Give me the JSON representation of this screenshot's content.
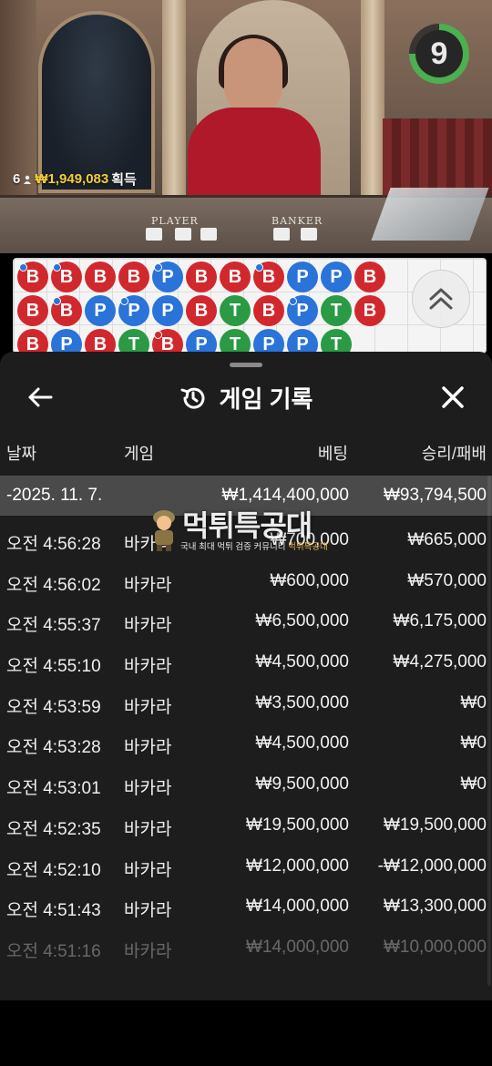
{
  "video": {
    "player_label": "PLAYER",
    "banker_label": "BANKER",
    "winners_count": "6",
    "winnings_amount": "₩1,949,083",
    "winnings_suffix": "획득",
    "timer": "9"
  },
  "roadmap": {
    "rows": [
      [
        {
          "r": "B",
          "dot": "blue"
        },
        {
          "r": "B",
          "dot": "blue"
        },
        {
          "r": "B"
        },
        {
          "r": "B"
        },
        {
          "r": "P",
          "dot": "blue"
        },
        {
          "r": "B"
        },
        {
          "r": "B"
        },
        {
          "r": "B",
          "dot": "blue"
        },
        {
          "r": "P"
        },
        {
          "r": "P"
        },
        {
          "r": "B"
        }
      ],
      [
        {
          "r": "B"
        },
        {
          "r": "B",
          "dot": "blue"
        },
        {
          "r": "P"
        },
        {
          "r": "P",
          "dot": "blue"
        },
        {
          "r": "P"
        },
        {
          "r": "B"
        },
        {
          "r": "T"
        },
        {
          "r": "B"
        },
        {
          "r": "P",
          "dot": "blue"
        },
        {
          "r": "T"
        },
        {
          "r": "B"
        }
      ],
      [
        {
          "r": "B"
        },
        {
          "r": "P"
        },
        {
          "r": "B"
        },
        {
          "r": "T"
        },
        {
          "r": "B",
          "dot": "red"
        },
        {
          "r": "P"
        },
        {
          "r": "T"
        },
        {
          "r": "P"
        },
        {
          "r": "P"
        },
        {
          "r": "T"
        }
      ]
    ],
    "colors": {
      "B": "#d1282e",
      "P": "#2a73d8",
      "T": "#2a9a44"
    }
  },
  "panel": {
    "title": "게임 기록",
    "headers": {
      "date": "날짜",
      "game": "게임",
      "bet": "베팅",
      "win": "승리/패배"
    },
    "total": {
      "date": "-2025. 11. 7.",
      "bet": "₩1,414,400,000",
      "win": "₩93,794,500"
    },
    "rows": [
      {
        "time": "오전 4:56:28",
        "game": "바카라",
        "bet": "₩700,000",
        "win": "₩665,000"
      },
      {
        "time": "오전 4:56:02",
        "game": "바카라",
        "bet": "₩600,000",
        "win": "₩570,000"
      },
      {
        "time": "오전 4:55:37",
        "game": "바카라",
        "bet": "₩6,500,000",
        "win": "₩6,175,000"
      },
      {
        "time": "오전 4:55:10",
        "game": "바카라",
        "bet": "₩4,500,000",
        "win": "₩4,275,000"
      },
      {
        "time": "오전 4:53:59",
        "game": "바카라",
        "bet": "₩3,500,000",
        "win": "₩0"
      },
      {
        "time": "오전 4:53:28",
        "game": "바카라",
        "bet": "₩4,500,000",
        "win": "₩0"
      },
      {
        "time": "오전 4:53:01",
        "game": "바카라",
        "bet": "₩9,500,000",
        "win": "₩0"
      },
      {
        "time": "오전 4:52:35",
        "game": "바카라",
        "bet": "₩19,500,000",
        "win": "₩19,500,000"
      },
      {
        "time": "오전 4:52:10",
        "game": "바카라",
        "bet": "₩12,000,000",
        "win": "-₩12,000,000"
      },
      {
        "time": "오전 4:51:43",
        "game": "바카라",
        "bet": "₩14,000,000",
        "win": "₩13,300,000"
      },
      {
        "time": "오전 4:51:16",
        "game": "바카라",
        "bet": "₩14,000,000",
        "win": "₩10,000,000"
      }
    ]
  },
  "watermark": {
    "title": "먹튀특공대",
    "subtitle": "국내 최대 먹튀 검증 커뮤니티",
    "subtitle_highlight": "먹튀특공대"
  },
  "icons": {
    "back": "arrow-left-icon",
    "history": "history-clock-icon",
    "close": "close-icon",
    "expand": "chevron-double-up-icon",
    "user": "user-icon"
  }
}
